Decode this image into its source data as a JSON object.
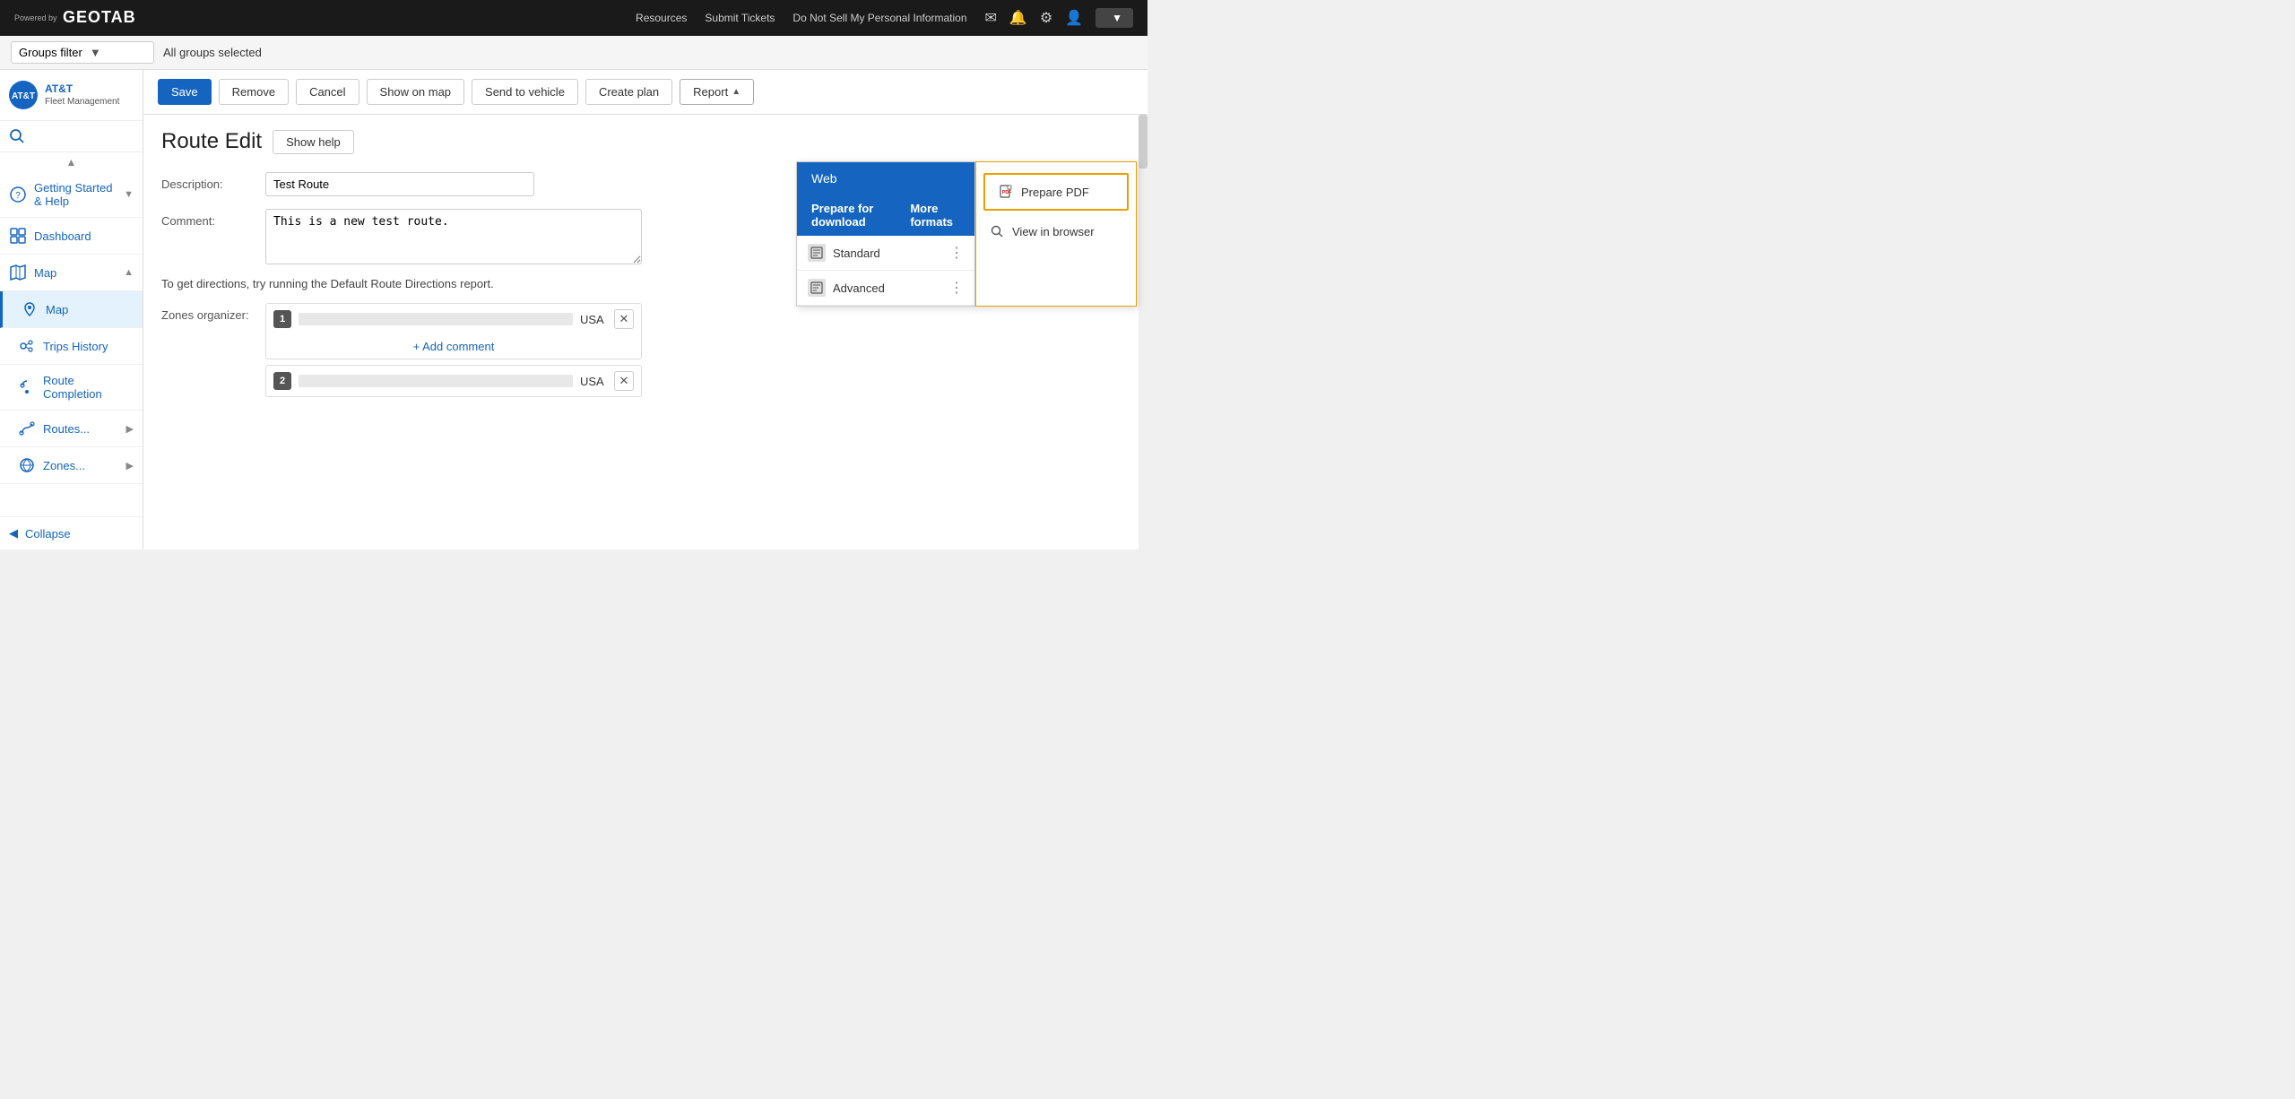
{
  "topbar": {
    "powered_by": "Powered by",
    "brand": "GEOTAB",
    "links": [
      "Resources",
      "Submit Tickets",
      "Do Not Sell My Personal Information"
    ],
    "icons": [
      "mail-icon",
      "bell-icon",
      "gear-icon",
      "user-icon"
    ],
    "user_menu_arrow": "▼"
  },
  "groups_bar": {
    "filter_label": "Groups filter",
    "filter_arrow": "▼",
    "selected_text": "All groups selected"
  },
  "sidebar": {
    "logo_initials": "AT&T",
    "brand_name": "AT&T",
    "brand_sub": "Fleet Management",
    "search_placeholder": "Search",
    "nav_items": [
      {
        "id": "getting-started",
        "label": "Getting Started & Help",
        "arrow": "▼",
        "icon": "help-circle-icon"
      },
      {
        "id": "dashboard",
        "label": "Dashboard",
        "arrow": "",
        "icon": "dashboard-icon"
      },
      {
        "id": "map",
        "label": "Map",
        "arrow": "▲",
        "icon": "map-icon",
        "active": true
      },
      {
        "id": "map-sub",
        "label": "Map",
        "arrow": "",
        "icon": "map-sub-icon",
        "sub": true,
        "active": true
      },
      {
        "id": "trips-history",
        "label": "Trips History",
        "arrow": "",
        "icon": "trips-icon",
        "sub": true
      },
      {
        "id": "route-completion",
        "label": "Route Completion",
        "arrow": "",
        "icon": "route-completion-icon",
        "sub": true
      },
      {
        "id": "routes",
        "label": "Routes...",
        "arrow": "▶",
        "icon": "routes-icon",
        "sub": true
      },
      {
        "id": "zones",
        "label": "Zones...",
        "arrow": "▶",
        "icon": "zones-icon",
        "sub": true
      }
    ],
    "collapse_label": "Collapse",
    "collapse_icon": "◀"
  },
  "toolbar": {
    "save_label": "Save",
    "remove_label": "Remove",
    "cancel_label": "Cancel",
    "show_on_map_label": "Show on map",
    "send_to_vehicle_label": "Send to vehicle",
    "create_plan_label": "Create plan",
    "report_label": "Report",
    "report_arrow": "▲"
  },
  "page": {
    "title": "Route Edit",
    "show_help_label": "Show help",
    "description_label": "Description:",
    "description_value": "Test Route",
    "description_placeholder": "Test Route",
    "comment_label": "Comment:",
    "comment_value": "This is a new test route.",
    "hint_text": "To get directions, try running the Default Route Directions report.",
    "zones_organizer_label": "Zones organizer:",
    "zones": [
      {
        "num": "1",
        "country": "USA"
      },
      {
        "num": "2",
        "country": "USA"
      }
    ],
    "add_comment_label": "+ Add comment"
  },
  "report_dropdown": {
    "web_label": "Web",
    "prepare_label": "Prepare for download",
    "more_formats_label": "More formats",
    "items": [
      {
        "id": "standard",
        "label": "Standard"
      },
      {
        "id": "advanced",
        "label": "Advanced"
      }
    ],
    "right_panel": {
      "prepare_pdf_label": "Prepare PDF",
      "view_browser_label": "View in browser"
    }
  }
}
